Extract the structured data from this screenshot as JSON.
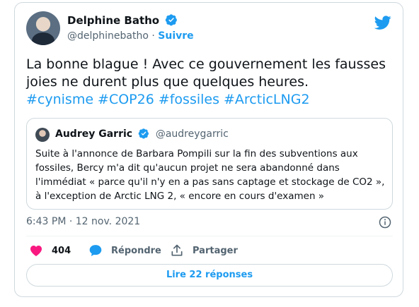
{
  "tweet": {
    "author_name": "Delphine Batho",
    "author_handle": "@delphinebatho",
    "separator": "·",
    "follow_label": "Suivre",
    "text": "La bonne blague ! Avec ce gouvernement les fausses joies ne durent plus que quelques heures.",
    "hashtags": [
      "#cynisme",
      "#COP26",
      "#fossiles",
      "#ArcticLNG2"
    ],
    "timestamp": "6:43 PM · 12 nov. 2021",
    "likes": "404",
    "reply_label": "Répondre",
    "share_label": "Partager",
    "read_replies_label": "Lire 22 réponses"
  },
  "quote": {
    "author_name": "Audrey Garric",
    "author_handle": "@audreygarric",
    "text": "Suite à l'annonce de Barbara Pompili sur la fin des subventions aux fossiles, Bercy m'a dit qu'aucun projet ne sera abandonné dans l'immédiat « parce qu'il n'y en a pas sans captage et stockage de CO2 », à l'exception de Arctic LNG 2, « encore en cours d'examen »"
  },
  "colors": {
    "accent": "#1d9bf0",
    "like": "#f91880",
    "text": "#0f1419",
    "muted": "#536471",
    "border": "#cfd9de"
  },
  "icons": [
    "verified-badge-icon",
    "twitter-bird-icon",
    "info-icon",
    "heart-icon",
    "reply-bubble-icon",
    "share-icon"
  ]
}
